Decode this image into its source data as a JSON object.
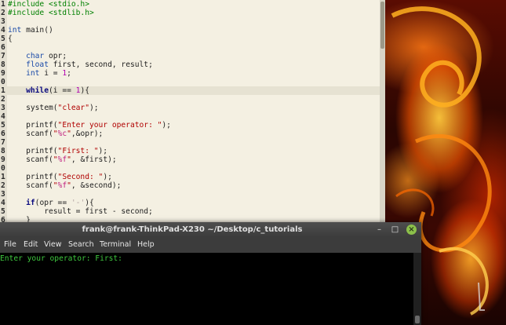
{
  "editor": {
    "lines": [
      {
        "ln": "1",
        "segs": [
          [
            "#include <stdio.h>",
            "kw-pp"
          ]
        ]
      },
      {
        "ln": "2",
        "segs": [
          [
            "#include <stdlib.h>",
            "kw-pp"
          ]
        ]
      },
      {
        "ln": "3",
        "segs": []
      },
      {
        "ln": "4",
        "segs": [
          [
            "int",
            "ty"
          ],
          [
            " main()",
            ""
          ]
        ]
      },
      {
        "ln": "5",
        "segs": [
          [
            "{",
            ""
          ]
        ]
      },
      {
        "ln": "6",
        "segs": []
      },
      {
        "ln": "7",
        "segs": [
          [
            "    ",
            ""
          ],
          [
            "char",
            "ty"
          ],
          [
            " opr;",
            ""
          ]
        ]
      },
      {
        "ln": "8",
        "segs": [
          [
            "    ",
            ""
          ],
          [
            "float",
            "ty"
          ],
          [
            " first, second, result;",
            ""
          ]
        ]
      },
      {
        "ln": "9",
        "segs": [
          [
            "    ",
            ""
          ],
          [
            "int",
            "ty"
          ],
          [
            " i = ",
            ""
          ],
          [
            "1",
            "num"
          ],
          [
            ";",
            ""
          ]
        ]
      },
      {
        "ln": "0",
        "segs": []
      },
      {
        "ln": "1",
        "current": true,
        "segs": [
          [
            "    ",
            ""
          ],
          [
            "while",
            "kw"
          ],
          [
            "(i == ",
            ""
          ],
          [
            "1",
            "num"
          ],
          [
            "){",
            ""
          ]
        ]
      },
      {
        "ln": "2",
        "segs": []
      },
      {
        "ln": "3",
        "segs": [
          [
            "    system(",
            ""
          ],
          [
            "\"clear\"",
            "st"
          ],
          [
            ");",
            ""
          ]
        ]
      },
      {
        "ln": "4",
        "segs": []
      },
      {
        "ln": "5",
        "segs": [
          [
            "    printf(",
            ""
          ],
          [
            "\"Enter your operator: \"",
            "st"
          ],
          [
            ");",
            ""
          ]
        ]
      },
      {
        "ln": "6",
        "segs": [
          [
            "    scanf(",
            ""
          ],
          [
            "\"",
            "st"
          ],
          [
            "%c",
            "fmt"
          ],
          [
            "\"",
            "st"
          ],
          [
            ",&opr);",
            ""
          ]
        ]
      },
      {
        "ln": "7",
        "segs": []
      },
      {
        "ln": "8",
        "segs": [
          [
            "    printf(",
            ""
          ],
          [
            "\"First: \"",
            "st"
          ],
          [
            ");",
            ""
          ]
        ]
      },
      {
        "ln": "9",
        "segs": [
          [
            "    scanf(",
            ""
          ],
          [
            "\"",
            "st"
          ],
          [
            "%f",
            "fmt"
          ],
          [
            "\"",
            "st"
          ],
          [
            ", &first);",
            ""
          ]
        ]
      },
      {
        "ln": "0",
        "segs": []
      },
      {
        "ln": "1",
        "segs": [
          [
            "    printf(",
            ""
          ],
          [
            "\"Second: \"",
            "st"
          ],
          [
            ");",
            ""
          ]
        ]
      },
      {
        "ln": "2",
        "segs": [
          [
            "    scanf(",
            ""
          ],
          [
            "\"",
            "st"
          ],
          [
            "%f",
            "fmt"
          ],
          [
            "\"",
            "st"
          ],
          [
            ", &second);",
            ""
          ]
        ]
      },
      {
        "ln": "3",
        "segs": []
      },
      {
        "ln": "4",
        "segs": [
          [
            "    ",
            ""
          ],
          [
            "if",
            "kw"
          ],
          [
            "(opr == ",
            ""
          ],
          [
            "'-'",
            "ch"
          ],
          [
            "){",
            ""
          ]
        ]
      },
      {
        "ln": "5",
        "segs": [
          [
            "        result = first - second;",
            ""
          ]
        ]
      },
      {
        "ln": "6",
        "segs": [
          [
            "    }",
            ""
          ]
        ]
      }
    ]
  },
  "terminal": {
    "title": "frank@frank-ThinkPad-X230 ~/Desktop/c_tutorials",
    "menu": [
      "File",
      "Edit",
      "View",
      "Search",
      "Terminal",
      "Help"
    ],
    "output": "Enter your operator: First:",
    "buttons": {
      "minimize": "–",
      "maximize": "□",
      "close": "×"
    }
  },
  "colors": {
    "editor_bg": "#f4f0e2",
    "terminal_bg": "#000000",
    "terminal_text": "#3ec83e",
    "close_button": "#8cc04a"
  }
}
